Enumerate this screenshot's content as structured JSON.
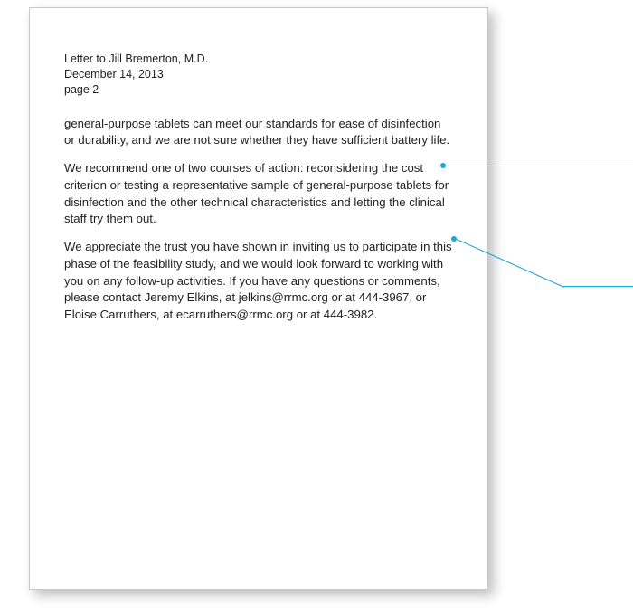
{
  "header": {
    "addressee": "Letter to Jill Bremerton, M.D.",
    "date": "December 14, 2013",
    "page_label": "page 2"
  },
  "paragraphs": {
    "p1": "general-purpose tablets can meet our standards for ease of disinfection or durability, and we are not sure whether they have sufficient battery life.",
    "p2": "We recommend one of two courses of action: reconsidering the cost criterion or testing a representative sample of general-purpose tablets for disinfection and the other technical characteristics and letting the clinical staff try them out.",
    "p3": "We appreciate the trust you have shown in inviting us to participate in this phase of the feasibility study, and we would look forward to working with you on any follow-up activities. If you have any questions or comments, please contact Jeremy Elkins, at jelkins@rrmc.org or at 444-3967, or Eloise Carruthers, at ecarruthers@rrmc.org or at 444-3982."
  },
  "callouts": {
    "color": "#17a7d6"
  }
}
